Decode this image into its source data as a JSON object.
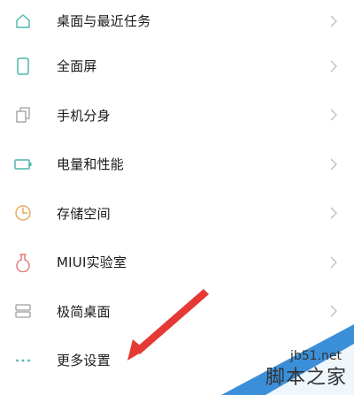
{
  "settings": {
    "items": [
      {
        "label": "桌面与最近任务",
        "icon": "home-icon",
        "color": "#4db6ac"
      },
      {
        "label": "全面屏",
        "icon": "phone-icon",
        "color": "#4db6ac"
      },
      {
        "label": "手机分身",
        "icon": "clone-icon",
        "color": "#9e9e9e"
      },
      {
        "label": "电量和性能",
        "icon": "battery-icon",
        "color": "#4db6ac"
      },
      {
        "label": "存储空间",
        "icon": "storage-pie-icon",
        "color": "#e8a95a"
      },
      {
        "label": "MIUI实验室",
        "icon": "flask-icon",
        "color": "#e57373"
      },
      {
        "label": "极简桌面",
        "icon": "minimal-desktop-icon",
        "color": "#9e9e9e"
      },
      {
        "label": "更多设置",
        "icon": "more-dots-icon",
        "color": "#4db6ac"
      }
    ]
  },
  "annotation": {
    "color": "#e53935"
  },
  "watermark": {
    "site": "jb51.net",
    "name": "脚本之家",
    "accent": "#3b8fd9"
  }
}
